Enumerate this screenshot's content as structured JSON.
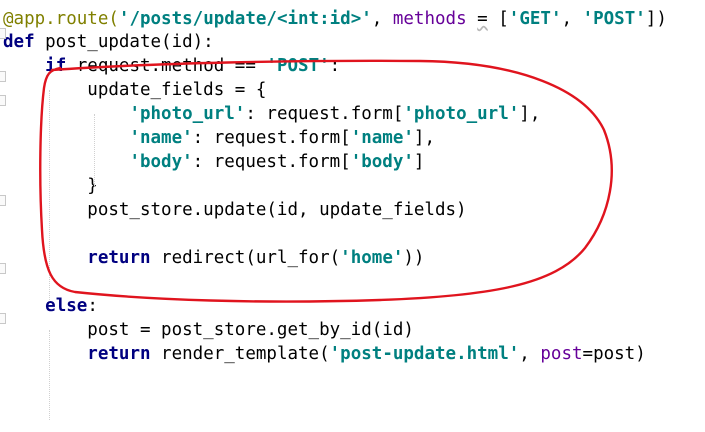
{
  "editor": {
    "language": "python",
    "colors": {
      "background": "#ffffff",
      "keyword": "#000080",
      "string": "#008080",
      "decorator": "#808000",
      "parameter": "#660099",
      "annotation_stroke": "#e0141e"
    },
    "lines": [
      {
        "id": "l1",
        "tokens": [
          {
            "t": "@app.route(",
            "c": "dec"
          },
          {
            "t": "'/posts/update/<int:id>'",
            "c": "str"
          },
          {
            "t": ", "
          },
          {
            "t": "methods",
            "c": "par"
          },
          {
            "t": " "
          },
          {
            "t": "=",
            "c": "warn"
          },
          {
            "t": " ["
          },
          {
            "t": "'GET'",
            "c": "str"
          },
          {
            "t": ", "
          },
          {
            "t": "'POST'",
            "c": "str"
          },
          {
            "t": "])"
          }
        ]
      },
      {
        "id": "l2",
        "tokens": [
          {
            "t": "def",
            "c": "kw"
          },
          {
            "t": " post_update(id):"
          }
        ]
      },
      {
        "id": "l3",
        "tokens": [
          {
            "t": "    "
          },
          {
            "t": "if",
            "c": "kw"
          },
          {
            "t": " request.method == "
          },
          {
            "t": "'POST'",
            "c": "str"
          },
          {
            "t": ":"
          }
        ]
      },
      {
        "id": "l4",
        "tokens": [
          {
            "t": "        update_fields = {"
          }
        ]
      },
      {
        "id": "l5",
        "tokens": [
          {
            "t": "            "
          },
          {
            "t": "'photo_url'",
            "c": "str"
          },
          {
            "t": ": request.form["
          },
          {
            "t": "'photo_url'",
            "c": "str"
          },
          {
            "t": "],"
          }
        ]
      },
      {
        "id": "l6",
        "tokens": [
          {
            "t": "            "
          },
          {
            "t": "'name'",
            "c": "str"
          },
          {
            "t": ": request.form["
          },
          {
            "t": "'name'",
            "c": "str"
          },
          {
            "t": "],"
          }
        ]
      },
      {
        "id": "l7",
        "tokens": [
          {
            "t": "            "
          },
          {
            "t": "'body'",
            "c": "str"
          },
          {
            "t": ": request.form["
          },
          {
            "t": "'body'",
            "c": "str"
          },
          {
            "t": "]"
          }
        ]
      },
      {
        "id": "l8",
        "tokens": [
          {
            "t": "        }"
          }
        ]
      },
      {
        "id": "l9",
        "tokens": [
          {
            "t": "        post_store.update(id, update_fields)"
          }
        ]
      },
      {
        "id": "l10",
        "tokens": []
      },
      {
        "id": "l11",
        "tokens": [
          {
            "t": "        "
          },
          {
            "t": "return",
            "c": "kw"
          },
          {
            "t": " redirect(url_for("
          },
          {
            "t": "'home'",
            "c": "str"
          },
          {
            "t": "))"
          }
        ]
      },
      {
        "id": "l12",
        "tokens": []
      },
      {
        "id": "l13",
        "tokens": [
          {
            "t": "    "
          },
          {
            "t": "else",
            "c": "kw"
          },
          {
            "t": ":"
          }
        ]
      },
      {
        "id": "l14",
        "tokens": [
          {
            "t": "        post = post_store.get_by_id(id)"
          }
        ]
      },
      {
        "id": "l15",
        "tokens": [
          {
            "t": "        "
          },
          {
            "t": "return",
            "c": "kw"
          },
          {
            "t": " render_template("
          },
          {
            "t": "'post-update.html'",
            "c": "str"
          },
          {
            "t": ", "
          },
          {
            "t": "post",
            "c": "par"
          },
          {
            "t": "=post)"
          }
        ]
      }
    ]
  }
}
